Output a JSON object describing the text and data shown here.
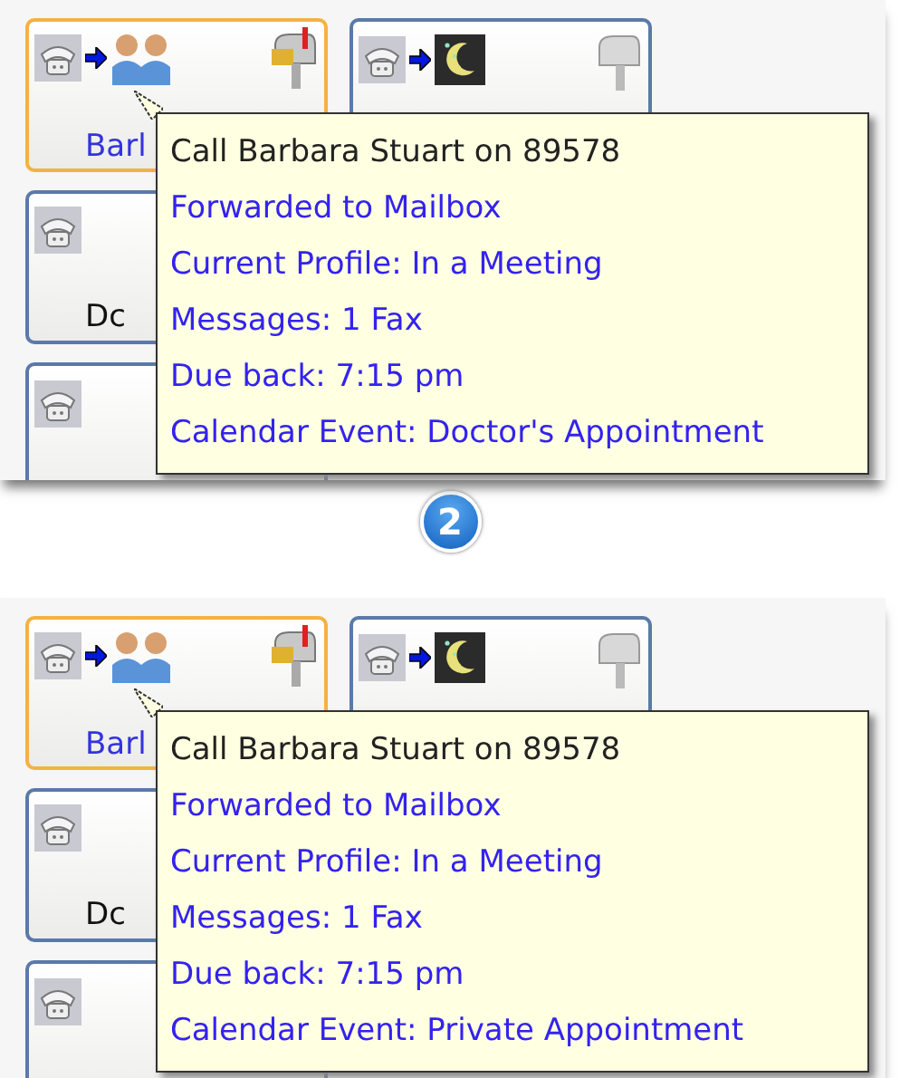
{
  "panels": [
    {
      "tiles": [
        {
          "label": "Barl",
          "selected": true,
          "icons": [
            {
              "kind": "people"
            },
            {
              "kind": "mailbox_flag"
            }
          ]
        },
        {
          "selected": false,
          "icons": [
            {
              "kind": "moon"
            },
            {
              "kind": "mailbox"
            }
          ]
        },
        {
          "label": "Dc",
          "selected": false
        },
        {
          "selected": false
        }
      ],
      "tooltip": {
        "title": "Call Barbara Stuart on 89578",
        "lines": [
          "Forwarded to Mailbox",
          "Current Profile: In a Meeting",
          "Messages: 1 Fax",
          "Due back: 7:15 pm",
          "Calendar Event: Doctor's Appointment"
        ]
      }
    },
    {
      "tiles": [
        {
          "label": "Barl",
          "selected": true,
          "icons": [
            {
              "kind": "people"
            },
            {
              "kind": "mailbox_flag"
            }
          ]
        },
        {
          "selected": false,
          "icons": [
            {
              "kind": "moon"
            },
            {
              "kind": "mailbox"
            }
          ]
        },
        {
          "label": "Dc",
          "selected": false
        },
        {
          "selected": false
        }
      ],
      "tooltip": {
        "title": "Call Barbara Stuart on 89578",
        "lines": [
          "Forwarded to Mailbox",
          "Current Profile: In a Meeting",
          "Messages: 1 Fax",
          "Due back: 7:15 pm",
          "Calendar Event: Private Appointment"
        ]
      }
    }
  ],
  "step_badge": "2"
}
